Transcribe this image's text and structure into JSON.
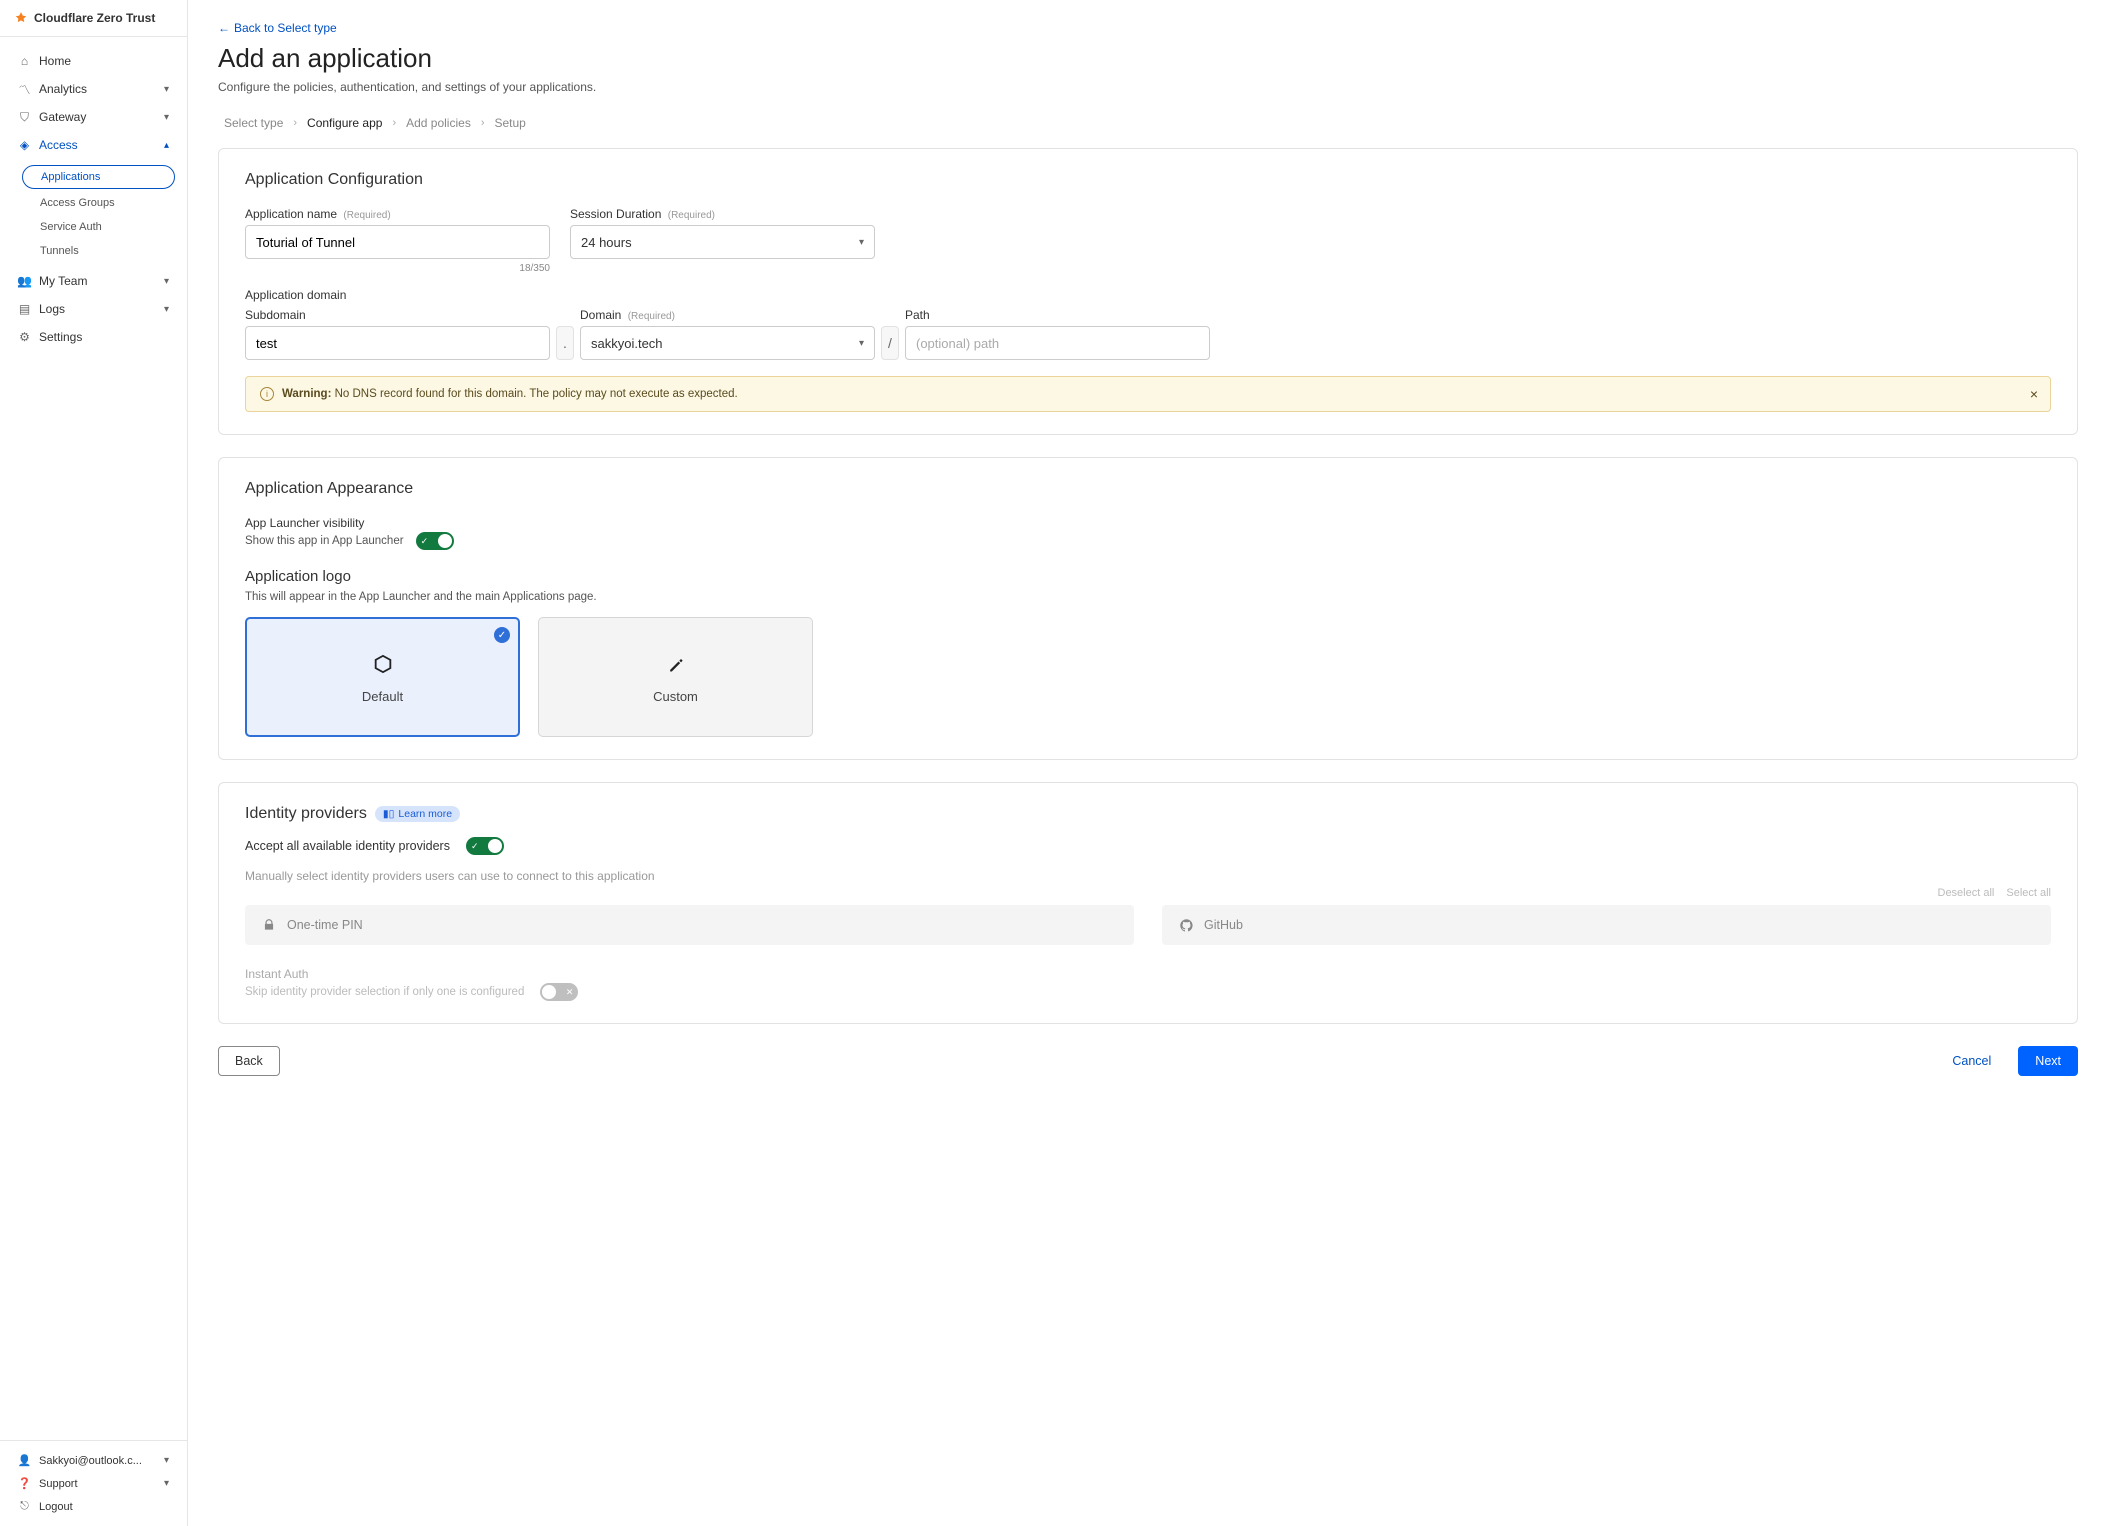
{
  "brand": "Cloudflare Zero Trust",
  "back_link": "Back to Select type",
  "page_title": "Add an application",
  "page_desc": "Configure the policies, authentication, and settings of your applications.",
  "nav": {
    "home": "Home",
    "analytics": "Analytics",
    "gateway": "Gateway",
    "access": "Access",
    "access_sub": {
      "applications": "Applications",
      "access_groups": "Access Groups",
      "service_auth": "Service Auth",
      "tunnels": "Tunnels"
    },
    "my_team": "My Team",
    "logs": "Logs",
    "settings": "Settings"
  },
  "footer_nav": {
    "user": "Sakkyoi@outlook.c...",
    "support": "Support",
    "logout": "Logout"
  },
  "steps": {
    "select_type": "Select type",
    "configure_app": "Configure app",
    "add_policies": "Add policies",
    "setup": "Setup"
  },
  "config": {
    "section_title": "Application Configuration",
    "app_name_label": "Application name",
    "app_name_value": "Toturial of Tunnel",
    "app_name_counter": "18/350",
    "session_label": "Session Duration",
    "session_value": "24 hours",
    "required": "(Required)",
    "domain_section": "Application domain",
    "subdomain_label": "Subdomain",
    "subdomain_value": "test",
    "domain_label": "Domain",
    "domain_value": "sakkyoi.tech",
    "path_label": "Path",
    "path_placeholder": "(optional) path",
    "dot": ".",
    "slash": "/",
    "warning_label": "Warning:",
    "warning_text": "No DNS record found for this domain. The policy may not execute as expected."
  },
  "appearance": {
    "section_title": "Application Appearance",
    "visibility_label": "App Launcher visibility",
    "visibility_desc": "Show this app in App Launcher",
    "logo_title": "Application logo",
    "logo_desc": "This will appear in the App Launcher and the main Applications page.",
    "default_label": "Default",
    "custom_label": "Custom"
  },
  "idp": {
    "section_title": "Identity providers",
    "learn_more": "Learn more",
    "accept_all": "Accept all available identity providers",
    "manual_desc": "Manually select identity providers users can use to connect to this application",
    "deselect_all": "Deselect all",
    "select_all": "Select all",
    "pin": "One-time PIN",
    "github": "GitHub",
    "instant_title": "Instant Auth",
    "instant_desc": "Skip identity provider selection if only one is configured"
  },
  "buttons": {
    "back": "Back",
    "cancel": "Cancel",
    "next": "Next"
  }
}
